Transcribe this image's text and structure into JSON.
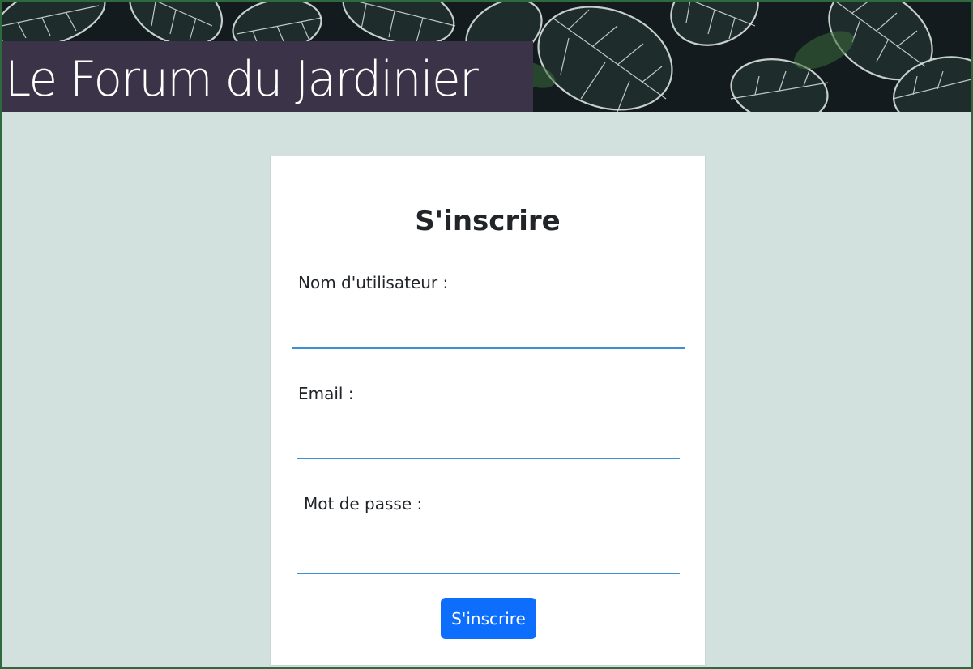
{
  "header": {
    "title": "Le Forum du Jardinier",
    "banner_image": "leaves-banner"
  },
  "form": {
    "title": "S'inscrire",
    "fields": [
      {
        "label": "Nom d'utilisateur :",
        "value": "",
        "placeholder": ""
      },
      {
        "label": "Email :",
        "value": "",
        "placeholder": ""
      },
      {
        "label": "Mot de passe :",
        "value": "",
        "placeholder": ""
      }
    ],
    "submit_label": "S'inscrire"
  },
  "colors": {
    "page_background": "#d2e1de",
    "title_box": "#3b3448",
    "input_underline": "#3d8fd6",
    "button": "#0d6efd"
  }
}
